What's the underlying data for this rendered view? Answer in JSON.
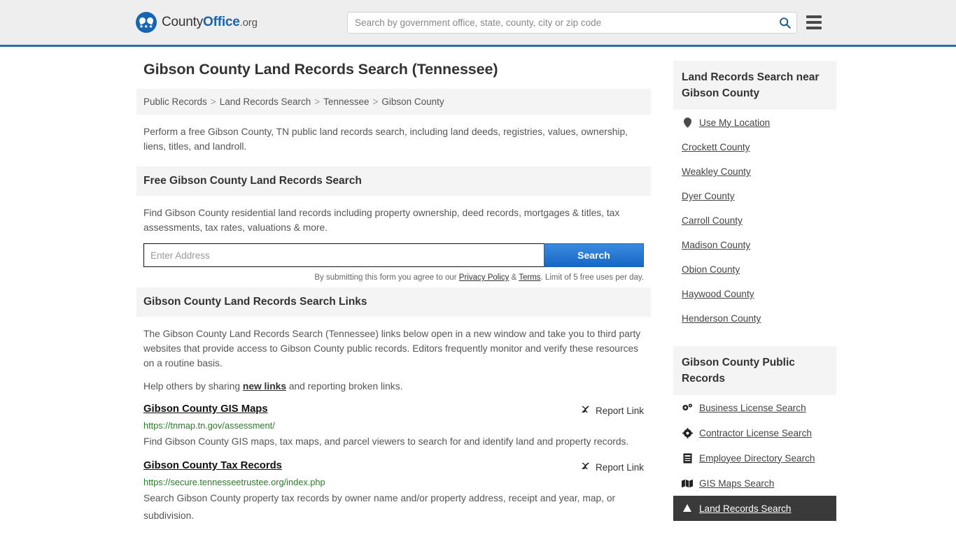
{
  "header": {
    "brand": {
      "part1": "County",
      "part2": "Office",
      "part3": ".org",
      "stars": "★★★"
    },
    "search_placeholder": "Search by government office, state, county, city or zip code",
    "search_value": "",
    "search_icon": "search-icon",
    "menu_icon": "hamburger-menu-icon"
  },
  "main": {
    "title": "Gibson County Land Records Search (Tennessee)",
    "breadcrumb": [
      "Public Records",
      "Land Records Search",
      "Tennessee",
      "Gibson County"
    ],
    "breadcrumb_separator": ">",
    "intro": "Perform a free Gibson County, TN public land records search, including land deeds, registries, values, ownership, liens, titles, and landroll.",
    "free_search": {
      "heading": "Free Gibson County Land Records Search",
      "description": "Find Gibson County residential land records including property ownership, deed records, mortgages & titles, tax assessments, tax rates, valuations & more.",
      "input_placeholder": "Enter Address",
      "input_value": "",
      "button_label": "Search",
      "fineprint_before": "By submitting this form you agree to our ",
      "privacy_label": "Privacy Policy",
      "fineprint_amp": " & ",
      "terms_label": "Terms",
      "fineprint_after": ". Limit of 5 free uses per day."
    },
    "links_section": {
      "heading": "Gibson County Land Records Search Links",
      "paragraph": "The Gibson County Land Records Search (Tennessee) links below open in a new window and take you to third party websites that provide access to Gibson County public records. Editors frequently monitor and verify these resources on a routine basis.",
      "help_before": "Help others by sharing ",
      "help_link": "new links",
      "help_after": " and reporting broken links.",
      "report_label": "Report Link",
      "report_icon": "broken-link-icon",
      "results": [
        {
          "title": "Gibson County GIS Maps",
          "url": "https://tnmap.tn.gov/assessment/",
          "description": "Find Gibson County GIS maps, tax maps, and parcel viewers to search for and identify land and property records."
        },
        {
          "title": "Gibson County Tax Records",
          "url": "https://secure.tennesseetrustee.org/index.php",
          "description": "Search Gibson County property tax records by owner name and/or property address, receipt and year, map, or subdivision."
        }
      ]
    }
  },
  "sidebar": {
    "near": {
      "heading": "Land Records Search near Gibson County",
      "items": [
        {
          "label": "Use My Location",
          "icon": "map-pin-icon"
        },
        {
          "label": "Crockett County",
          "icon": ""
        },
        {
          "label": "Weakley County",
          "icon": ""
        },
        {
          "label": "Dyer County",
          "icon": ""
        },
        {
          "label": "Carroll County",
          "icon": ""
        },
        {
          "label": "Madison County",
          "icon": ""
        },
        {
          "label": "Obion County",
          "icon": ""
        },
        {
          "label": "Haywood County",
          "icon": ""
        },
        {
          "label": "Henderson County",
          "icon": ""
        }
      ]
    },
    "public_records": {
      "heading": "Gibson County Public Records",
      "items": [
        {
          "label": "Business License Search",
          "icon": "gears-icon",
          "active": false
        },
        {
          "label": "Contractor License Search",
          "icon": "gear-icon",
          "active": false
        },
        {
          "label": "Employee Directory Search",
          "icon": "document-icon",
          "active": false
        },
        {
          "label": "GIS Maps Search",
          "icon": "map-icon",
          "active": false
        },
        {
          "label": "Land Records Search",
          "icon": "land-icon",
          "active": true
        }
      ]
    }
  },
  "colors": {
    "brand_blue": "#1565b0",
    "header_bg": "#eeeeee",
    "header_border": "#2b6ca3",
    "panel_bg": "#f4f4f4",
    "button_blue": "#1667c5",
    "url_green": "#2b7a2b",
    "active_bg": "#3a3a3a"
  }
}
